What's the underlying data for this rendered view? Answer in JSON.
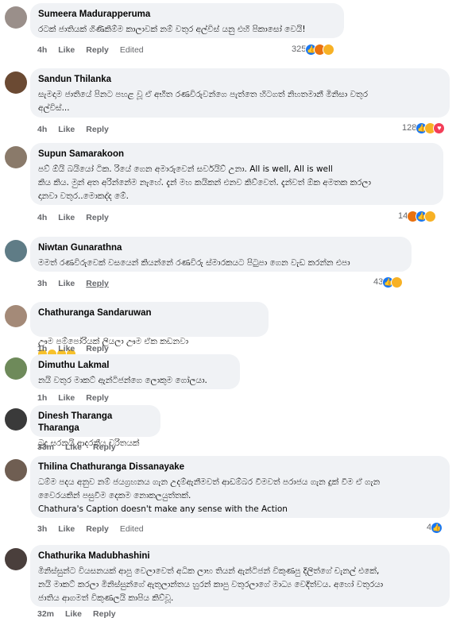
{
  "comments": [
    {
      "author": "Sumeera Madurapperuma",
      "text": "රටක් ජාතියක් ගිණිකිම්ම කාලාවක් නම් වතුර අල්විස් යනු එහි පිකාසෝ වෙයි!",
      "time": "4h",
      "like": "Like",
      "reply": "Reply",
      "edited": "Edited",
      "reaction_count": "325",
      "reactions": [
        "like-icon",
        "angry-icon",
        "haha-icon"
      ],
      "avatar_color": "#9a8f8a"
    },
    {
      "author": "Sandun Thilanka",
      "text": "සැමදාම ජාතියේ පිනට පහළ වූ ඒ අභීත රණවිරුවන්ගෙ පැත්තෙ හිටගත් නිහතමානී මිනිසා වතුර\nඅල්විස්...",
      "time": "4h",
      "like": "Like",
      "reply": "Reply",
      "edited": "",
      "reaction_count": "128",
      "reactions": [
        "like-icon",
        "haha-icon",
        "love-icon"
      ],
      "avatar_color": "#6b4a33"
    },
    {
      "author": "Supun Samarakoon",
      "text": "පව් ඕයි බයියෝ ටික. රියේ ගෙන අමාරුවෙන් සර්වයිව් උනා. All is well, All is well\nකිය කිය. මුන් අත අරින්නේම නැහේ. දැන් මහ කයිකන් එනව කිව්වෙත්. දැන්වත් ඕක අමතක කරලා\nදානවා වතුර..මොකද්ද මේ.",
      "time": "4h",
      "like": "Like",
      "reply": "Reply",
      "edited": "",
      "reaction_count": "14",
      "reactions": [
        "angry-icon",
        "like-icon",
        "haha-icon"
      ],
      "avatar_color": "#8a7a6a"
    },
    {
      "author": "Niwtan Gunarathna",
      "text": "මමත් රණවිරුවෙක් වසයෙන් කියන්නේ රණවිරු ස්මාරකයට පිටුපා ගෙන වැඩ කරන්න එපා",
      "time": "3h",
      "like": "Like",
      "reply": "Reply",
      "edited": "",
      "reaction_count": "43",
      "reactions": [
        "like-icon",
        "haha-icon"
      ],
      "avatar_color": "#5f7c86"
    },
    {
      "author": "Chathuranga Sandaruwan",
      "text": "ඌම පම්පෝරියක් ලියලා ඌම ඒක කඩනවා",
      "time": "1h",
      "like": "Like",
      "reply": "Reply",
      "edited": "",
      "reaction_count": "",
      "reactions": [],
      "avatar_color": "#a48a78"
    },
    {
      "author": "Dimuthu Lakmal",
      "text": "නයි වතුර මාකට් ඇන්ටිජන්ගෙ ලොකුම ගෝලයා.",
      "time": "1h",
      "like": "Like",
      "reply": "Reply",
      "edited": "",
      "reaction_count": "",
      "reactions": [],
      "avatar_color": "#6e8a5a"
    },
    {
      "author": "Dinesh Tharanga Tharanga",
      "text": "බුදු සරනයි ආදරනීය චරිතයක්",
      "time": "33m",
      "like": "Like",
      "reply": "Reply",
      "edited": "",
      "reaction_count": "",
      "reactions": [],
      "avatar_color": "#3a3a3a"
    },
    {
      "author": "Thilina Chathuranga Dissanayake",
      "text": "ධම්ම පදය අනුව නම් ජයග්‍රහනය ගැන උදම්ඇනීමවත් ආඩම්බර වීමවත් පරාජය ගැන දුක් වීම ඒ ගැන\nවෛරයකින් පසුවීම දෙකම නොකලයුත්තක්.\nChathura's Caption doesn't make any sense with the Action",
      "time": "3h",
      "like": "Like",
      "reply": "Reply",
      "edited": "Edited",
      "reaction_count": "4",
      "reactions": [
        "like-icon"
      ],
      "avatar_color": "#6f5e52"
    },
    {
      "author": "Chathurika Madubhashini",
      "text": "මිනිස්සුන්ට වියසනයක් ආපු වෙලාවෙත් අධික ලාභ තියන් ඇන්ටිජන් විකුණපු දිලිත්ගේ චැනල් එකේ,\nනයි මාකට් කරලා මිනිස්සුන්ගේ ඇතුලාන්තය හුරන් කාපු වතුරලාගේ මාධ්‍ය වෙදිත්වය. අහෝ වතුරයා\nජාතිය ආගමත් විකුණලයි කාපිය කිව්වූ.",
      "time": "32m",
      "like": "Like",
      "reply": "Reply",
      "edited": "",
      "reaction_count": "",
      "reactions": [],
      "avatar_color": "#4a3f3c"
    }
  ]
}
